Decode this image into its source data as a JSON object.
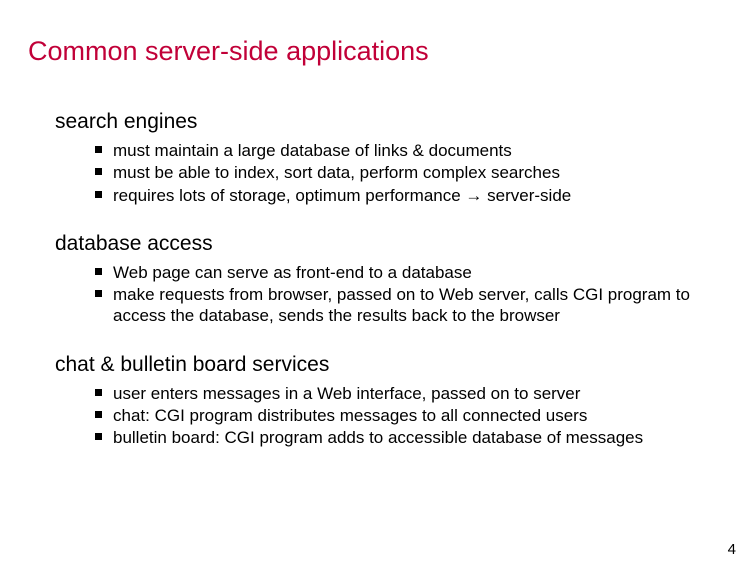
{
  "title": "Common server-side applications",
  "sections": [
    {
      "heading": "search engines",
      "bullets": [
        "must maintain a large database of links & documents",
        "must be able to index, sort data, perform complex searches",
        "requires lots of storage, optimum performance → server-side"
      ]
    },
    {
      "heading": "database access",
      "bullets": [
        "Web page can serve as front-end to a database",
        "make requests from browser, passed on to Web server, calls CGI program to access the database, sends the results back to the browser"
      ]
    },
    {
      "heading": "chat & bulletin board services",
      "bullets": [
        "user enters messages in a Web interface, passed on to server",
        "chat: CGI program distributes messages to all connected users",
        "bulletin board: CGI program adds to accessible database of messages"
      ]
    }
  ],
  "page_number": "4"
}
